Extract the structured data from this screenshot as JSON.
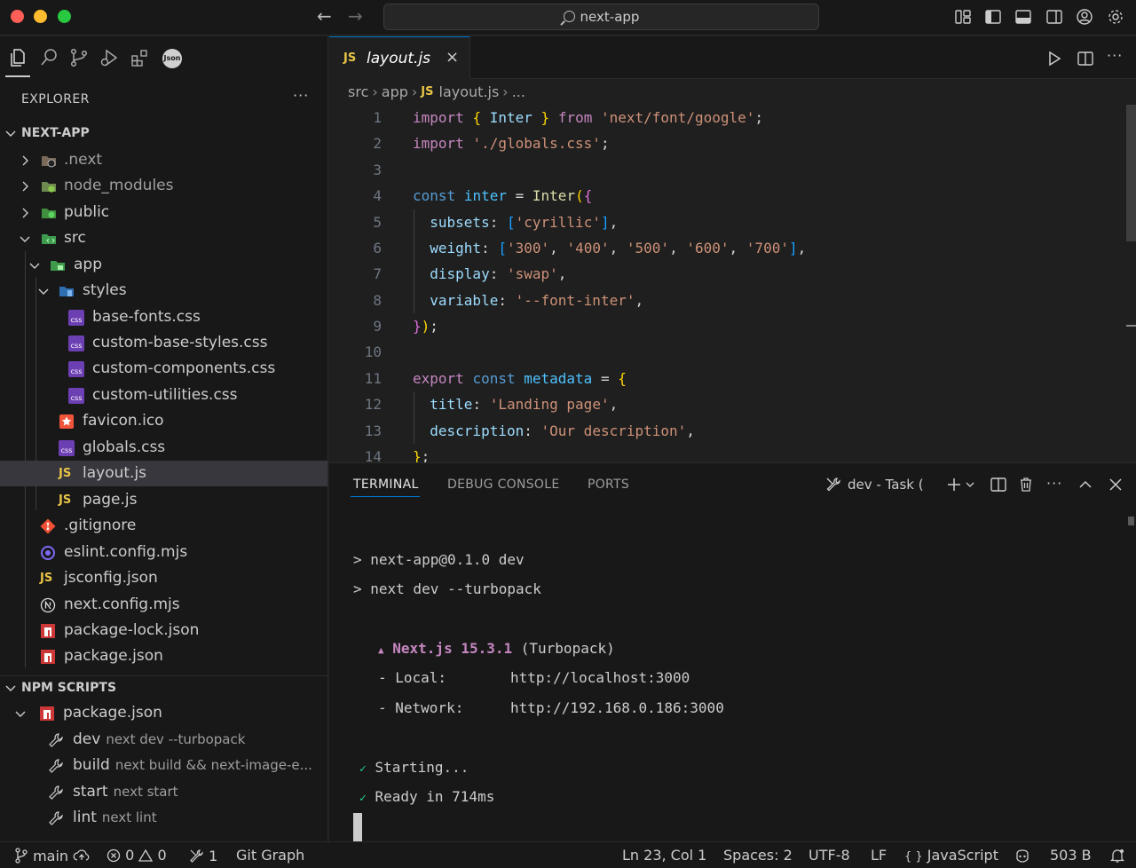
{
  "window": {
    "title": "next-app"
  },
  "activity_bar": {
    "icons": [
      "explorer-icon",
      "search-icon",
      "source-control-icon",
      "run-debug-icon",
      "extensions-icon",
      "json-icon"
    ],
    "json_badge": "Json"
  },
  "explorer": {
    "title": "EXPLORER",
    "more": "···",
    "project": "NEXT-APP",
    "items": [
      {
        "name": ".next",
        "type": "folder"
      },
      {
        "name": "node_modules",
        "type": "folder"
      },
      {
        "name": "public",
        "type": "folder"
      },
      {
        "name": "src",
        "type": "folder"
      },
      {
        "name": "app",
        "type": "folder"
      },
      {
        "name": "styles",
        "type": "folder"
      },
      {
        "name": "base-fonts.css",
        "type": "css"
      },
      {
        "name": "custom-base-styles.css",
        "type": "css"
      },
      {
        "name": "custom-components.css",
        "type": "css"
      },
      {
        "name": "custom-utilities.css",
        "type": "css"
      },
      {
        "name": "favicon.ico",
        "type": "ico"
      },
      {
        "name": "globals.css",
        "type": "css"
      },
      {
        "name": "layout.js",
        "type": "js"
      },
      {
        "name": "page.js",
        "type": "js"
      },
      {
        "name": ".gitignore",
        "type": "git"
      },
      {
        "name": "eslint.config.mjs",
        "type": "eslint"
      },
      {
        "name": "jsconfig.json",
        "type": "js-json"
      },
      {
        "name": "next.config.mjs",
        "type": "next"
      },
      {
        "name": "package-lock.json",
        "type": "npm"
      },
      {
        "name": "package.json",
        "type": "npm"
      }
    ],
    "js_badge": "JS",
    "css_badge": "css"
  },
  "npm_scripts": {
    "title": "NPM SCRIPTS",
    "file": "package.json",
    "scripts": [
      {
        "name": "dev",
        "command": "next dev --turbopack"
      },
      {
        "name": "build",
        "command": "next build && next-image-e..."
      },
      {
        "name": "start",
        "command": "next start"
      },
      {
        "name": "lint",
        "command": "next lint"
      }
    ]
  },
  "editor": {
    "tab_label": "layout.js",
    "tab_badge": "JS",
    "close": "×",
    "breadcrumbs": [
      "src",
      "app",
      "layout.js",
      "..."
    ],
    "line_numbers": [
      "1",
      "2",
      "3",
      "4",
      "5",
      "6",
      "7",
      "8",
      "9",
      "10",
      "11",
      "12",
      "13",
      "14"
    ]
  },
  "panel": {
    "tabs": [
      "TERMINAL",
      "DEBUG CONSOLE",
      "PORTS"
    ],
    "task": "dev - Task",
    "terminal_lines": [
      "> next-app@0.1.0 dev",
      "> next dev --turbopack",
      "Next.js 15.3.1",
      "(Turbopack)",
      "- Local:",
      "http://localhost:3000",
      "- Network:",
      "http://192.168.0.186:3000",
      "Starting...",
      "Ready in 714ms"
    ],
    "marks": {
      "triangle": "▲",
      "check": "✓"
    }
  },
  "status_bar": {
    "branch": "main",
    "errors": "0",
    "warnings": "0",
    "ports": "1",
    "git_graph": "Git Graph",
    "position": "Ln 23, Col 1",
    "spaces": "Spaces: 2",
    "encoding": "UTF-8",
    "eol": "LF",
    "language": "JavaScript",
    "language_icon": "{ }",
    "size": "503 B"
  },
  "colors": {
    "accent": "#0078d4",
    "keyword": "#c586c0",
    "string": "#ce9178",
    "js_badge": "#e8c547",
    "terminal_green": "#23d18b"
  }
}
